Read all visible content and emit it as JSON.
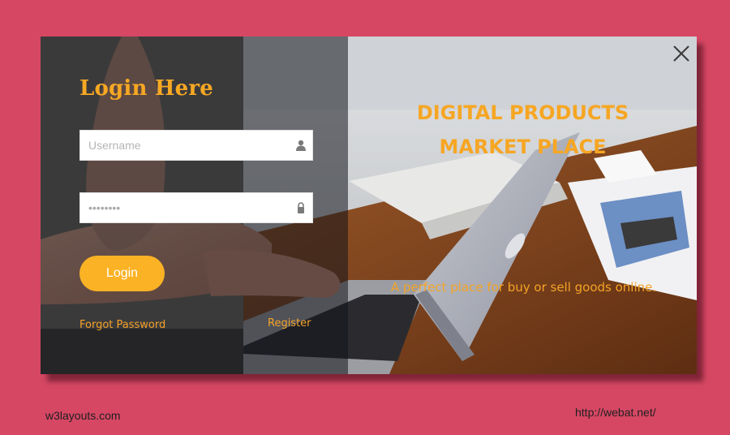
{
  "form": {
    "title": "Login Here",
    "username_placeholder": "Username",
    "username_icon": "user-icon",
    "password_value": "••••••••",
    "password_icon": "lock-icon",
    "login_label": "Login",
    "forgot_label": "Forgot Password",
    "register_label": "Register"
  },
  "hero": {
    "headline_line1": "DIGITAL PRODUCTS",
    "headline_line2": "MARKET PLACE",
    "tagline": "A perfect place for buy or sell goods online."
  },
  "footer": {
    "left_text": "w3layouts.com",
    "right_text": "http://webat.net/"
  },
  "colors": {
    "page_background": "#d64764",
    "accent": "#fbb225",
    "text_accent": "#f6a623"
  },
  "icons": [
    "close-icon",
    "user-icon",
    "lock-icon"
  ]
}
